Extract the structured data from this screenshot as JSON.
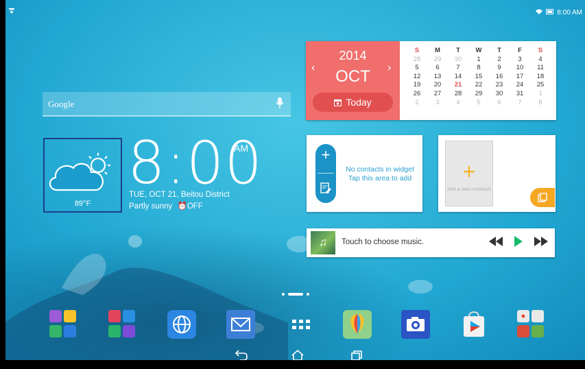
{
  "status_bar": {
    "time": "8:00 AM",
    "icons": [
      "download-icon",
      "wifi-icon",
      "battery-icon"
    ]
  },
  "search_widget": {
    "logo_text": "Google",
    "mic_icon": "mic-icon"
  },
  "calendar": {
    "year": "2014",
    "month": "OCT",
    "today_label": "Today",
    "weekdays": [
      "S",
      "M",
      "T",
      "W",
      "T",
      "F",
      "S"
    ],
    "weeks": [
      [
        "28",
        "29",
        "30",
        "1",
        "2",
        "3",
        "4"
      ],
      [
        "5",
        "6",
        "7",
        "8",
        "9",
        "10",
        "11"
      ],
      [
        "12",
        "13",
        "14",
        "15",
        "16",
        "17",
        "18"
      ],
      [
        "19",
        "20",
        "21",
        "22",
        "23",
        "24",
        "25"
      ],
      [
        "26",
        "27",
        "28",
        "29",
        "30",
        "31",
        "1"
      ],
      [
        "2",
        "3",
        "4",
        "5",
        "6",
        "7",
        "8"
      ]
    ],
    "today": "21",
    "accent": "#f06e6c"
  },
  "weather": {
    "temperature": "89°F",
    "condition": "Partly sunny",
    "icon": "partly-sunny-icon"
  },
  "clock": {
    "time": "8:00",
    "ampm": "AM",
    "date_location": "TUE, OCT 21, Beitou District",
    "alarm": "OFF"
  },
  "contacts_widget": {
    "line1": "No contacts in widget",
    "line2": "Tap this area to add"
  },
  "notebook_widget": {
    "add_label": "Add a new notebook"
  },
  "music_widget": {
    "prompt": "Touch to choose music."
  },
  "dock": [
    {
      "name": "folder-1"
    },
    {
      "name": "folder-2"
    },
    {
      "name": "browser",
      "icon": "globe-icon"
    },
    {
      "name": "email",
      "icon": "envelope-icon"
    },
    {
      "name": "all-apps",
      "icon": "apps-grid-icon"
    },
    {
      "name": "gallery",
      "icon": "balloon-icon"
    },
    {
      "name": "camera",
      "icon": "camera-icon"
    },
    {
      "name": "play-store",
      "icon": "shopping-bag-icon"
    },
    {
      "name": "google-folder"
    }
  ],
  "navigation": [
    "back-icon",
    "home-icon",
    "recents-icon"
  ]
}
